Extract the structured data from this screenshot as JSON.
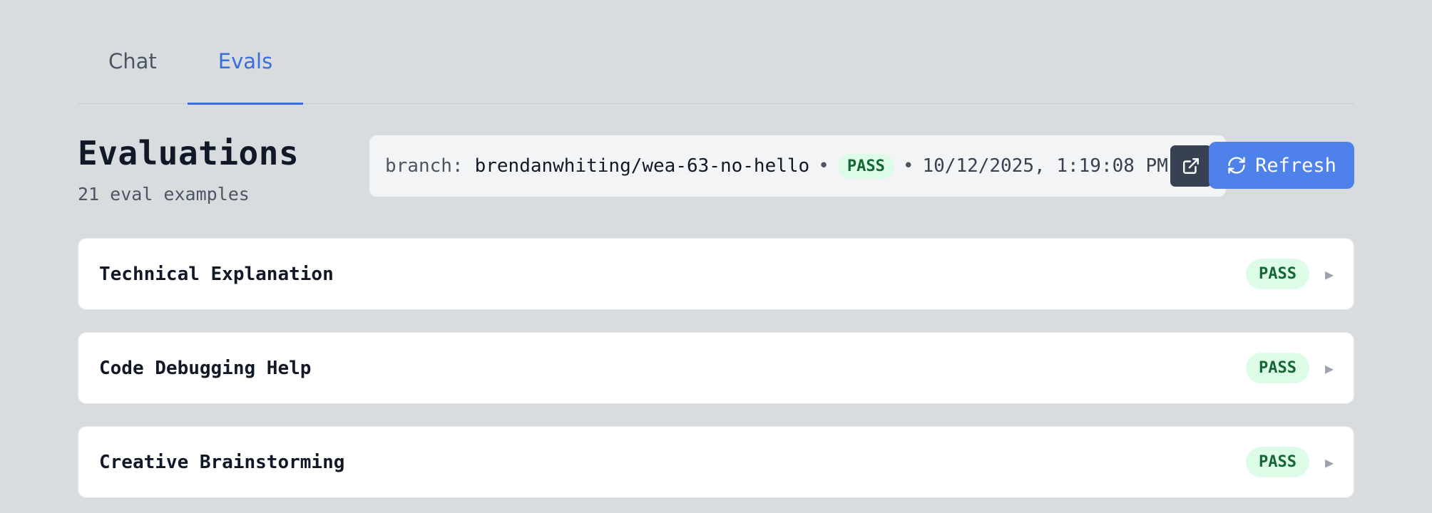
{
  "tabs": [
    {
      "label": "Chat",
      "active": false
    },
    {
      "label": "Evals",
      "active": true
    }
  ],
  "header": {
    "title": "Evaluations",
    "subtitle": "21 eval examples"
  },
  "run_info": {
    "branch_label": "branch:",
    "branch_name": "brendanwhiting/wea-63-no-hello",
    "separator": "•",
    "status": "PASS",
    "timestamp": "10/12/2025, 1:19:08 PM",
    "open_icon": "external-link-icon"
  },
  "refresh": {
    "label": "Refresh",
    "icon": "refresh-icon"
  },
  "evals": [
    {
      "name": "Technical Explanation",
      "status": "PASS"
    },
    {
      "name": "Code Debugging Help",
      "status": "PASS"
    },
    {
      "name": "Creative Brainstorming",
      "status": "PASS"
    }
  ],
  "colors": {
    "accent": "#3b6ce0",
    "refresh_button": "#4e82ea",
    "pass_bg": "#dcfce7",
    "pass_text": "#166534",
    "background": "#d9dcde"
  }
}
